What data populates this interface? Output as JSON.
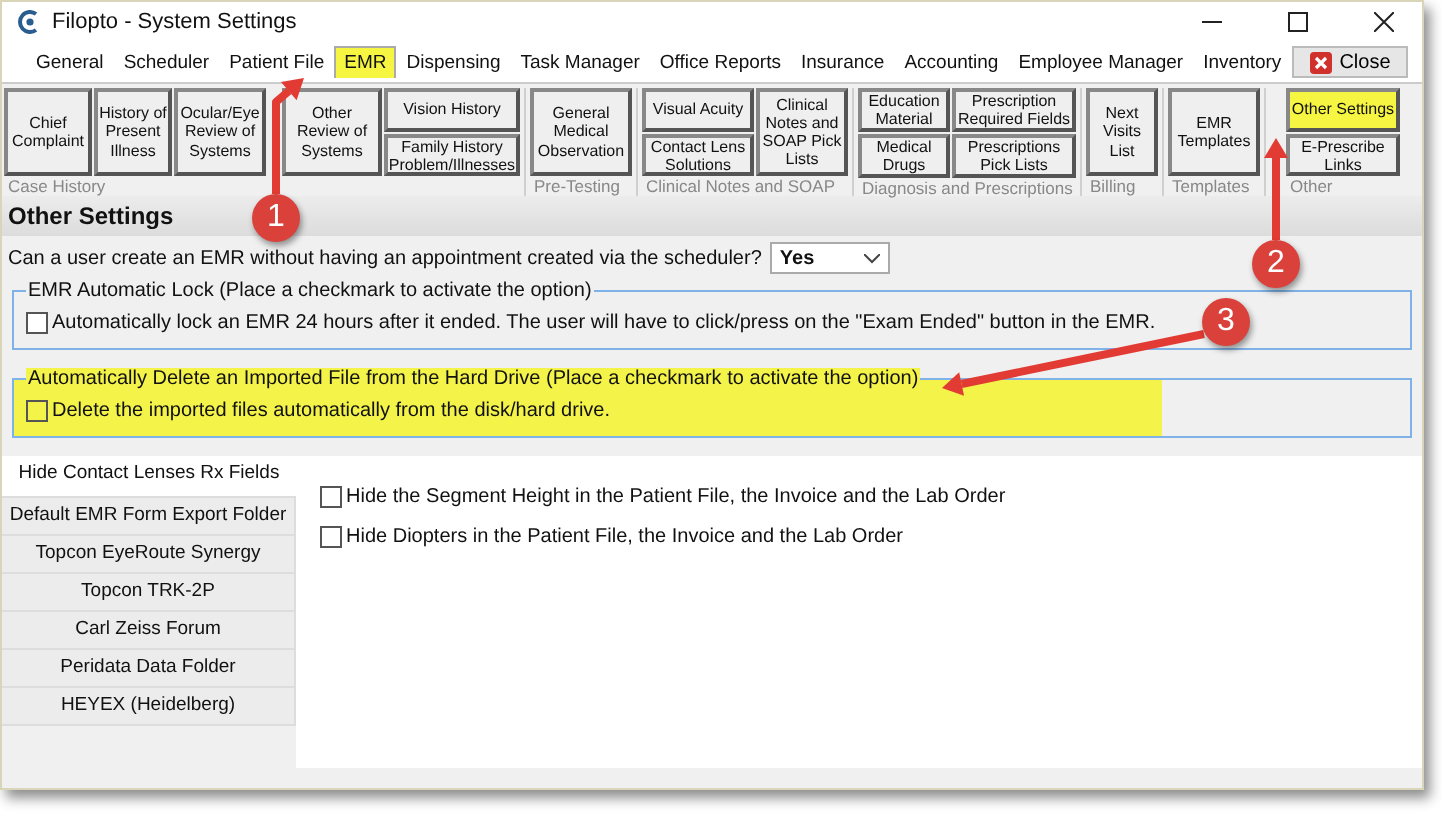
{
  "window": {
    "title": "Filopto - System Settings"
  },
  "menu": [
    {
      "label": "General",
      "selected": false,
      "highlighted": false
    },
    {
      "label": "Scheduler",
      "selected": false,
      "highlighted": false
    },
    {
      "label": "Patient File",
      "selected": false,
      "highlighted": false
    },
    {
      "label": "EMR",
      "selected": true,
      "highlighted": true
    },
    {
      "label": "Dispensing",
      "selected": false,
      "highlighted": false
    },
    {
      "label": "Task Manager",
      "selected": false,
      "highlighted": false
    },
    {
      "label": "Office Reports",
      "selected": false,
      "highlighted": false
    },
    {
      "label": "Insurance",
      "selected": false,
      "highlighted": false
    },
    {
      "label": "Accounting",
      "selected": false,
      "highlighted": false
    },
    {
      "label": "Employee Manager",
      "selected": false,
      "highlighted": false
    },
    {
      "label": "Inventory",
      "selected": false,
      "highlighted": false
    }
  ],
  "close_button": {
    "label": "Close"
  },
  "toolbar": [
    {
      "label": "Case History",
      "columns": [
        [
          {
            "label": "Chief Complaint",
            "highlighted": false
          }
        ],
        [
          {
            "label": "History of Present Illness",
            "highlighted": false
          }
        ],
        [
          {
            "label": "Ocular/Eye Review of Systems",
            "highlighted": false
          }
        ],
        [
          {
            "label": "Other Review of Systems",
            "highlighted": false
          }
        ],
        [
          {
            "label": "Vision History",
            "highlighted": false
          },
          {
            "label": "Family History Problem/Illnesses",
            "highlighted": false
          }
        ]
      ]
    },
    {
      "label": "Pre-Testing",
      "columns": [
        [
          {
            "label": "General Medical Observation",
            "highlighted": false
          }
        ]
      ]
    },
    {
      "label": "Clinical Notes and SOAP",
      "columns": [
        [
          {
            "label": "Visual Acuity",
            "highlighted": false
          },
          {
            "label": "Contact Lens Solutions",
            "highlighted": false
          }
        ],
        [
          {
            "label": "Clinical Notes and SOAP Pick Lists",
            "highlighted": false
          }
        ]
      ]
    },
    {
      "label": "Diagnosis and Prescriptions",
      "columns": [
        [
          {
            "label": "Education Material",
            "highlighted": false
          },
          {
            "label": "Medical Drugs",
            "highlighted": false
          }
        ],
        [
          {
            "label": "Prescription Required Fields",
            "highlighted": false
          },
          {
            "label": "Prescriptions Pick Lists",
            "highlighted": false
          }
        ]
      ]
    },
    {
      "label": "Billing",
      "columns": [
        [
          {
            "label": "Next Visits List",
            "highlighted": false
          }
        ]
      ]
    },
    {
      "label": "Templates",
      "columns": [
        [
          {
            "label": "EMR Templates",
            "highlighted": false
          }
        ]
      ]
    },
    {
      "label": "Other",
      "columns": [
        [
          {
            "label": "Other Settings",
            "highlighted": true
          },
          {
            "label": "E-Prescribe Links",
            "highlighted": false
          }
        ]
      ]
    }
  ],
  "section_title": "Other Settings",
  "question": {
    "text": "Can a user create an EMR without having an appointment created via the scheduler?",
    "value": "Yes"
  },
  "option_groups": [
    {
      "legend": "EMR Automatic Lock (Place a checkmark to activate the option)",
      "highlighted": false,
      "options": [
        {
          "label": "Automatically lock an EMR 24 hours after it ended.  The user will have to click/press on the \"Exam Ended\" button in the EMR.",
          "checked": false
        }
      ]
    },
    {
      "legend": "Automatically Delete an Imported File from the Hard Drive (Place a checkmark to activate the option)",
      "highlighted": true,
      "options": [
        {
          "label": "Delete the imported files automatically from the disk/hard drive.",
          "checked": false
        }
      ]
    }
  ],
  "side_tabs": [
    {
      "label": "Hide Contact Lenses Rx Fields",
      "selected": true
    },
    {
      "label": "Default EMR Form Export Folder",
      "selected": false
    },
    {
      "label": "Topcon EyeRoute Synergy",
      "selected": false
    },
    {
      "label": "Topcon TRK-2P",
      "selected": false
    },
    {
      "label": "Carl Zeiss Forum",
      "selected": false
    },
    {
      "label": "Peridata Data Folder",
      "selected": false
    },
    {
      "label": "HEYEX (Heidelberg)",
      "selected": false
    }
  ],
  "options": [
    {
      "label": "Hide the Segment Height in the Patient File, the Invoice and the Lab Order",
      "checked": false
    },
    {
      "label": "Hide Diopters in the Patient File, the Invoice and the Lab Order",
      "checked": false
    }
  ],
  "callouts": [
    {
      "number": "1"
    },
    {
      "number": "2"
    },
    {
      "number": "3"
    }
  ]
}
